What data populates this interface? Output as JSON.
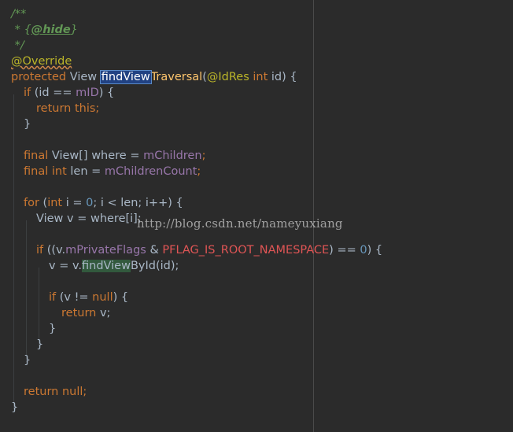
{
  "code": {
    "doc_open": "/**",
    "doc_line": " * {@hide}",
    "doc_close": " */",
    "annotation": "@Override",
    "sig_protected": "protected",
    "sig_view": "View",
    "sig_method": "findView",
    "sig_method_rest": "Traversal",
    "sig_params_open": "(",
    "sig_idres": "@IdRes",
    "sig_int": "int",
    "sig_params_close": " id) {",
    "if1_kw": "if",
    "if1_open": " (id == ",
    "if1_field": "mID",
    "if1_close": ") {",
    "ret_this_kw": "return",
    "ret_this_val": " this;",
    "close_brace": "}",
    "final1_kw": "final",
    "final1_type": " View[] where = ",
    "final1_field": "mChildren",
    "semicolon": ";",
    "final2_kw": "final",
    "final2_int": " int",
    "final2_name": " len = ",
    "final2_field": "mChildrenCount",
    "for_kw": "for",
    "for_open": " (",
    "for_int": "int",
    "for_i": " i = ",
    "for_zero": "0",
    "for_rest": "; i < len; i++) {",
    "view_v": "View v = where[i];",
    "if2_kw": "if",
    "if2_open": " ((v.",
    "if2_field": "mPrivateFlags",
    "if2_amp": " & ",
    "if2_const": "PFLAG_IS_ROOT_NAMESPACE",
    "if2_eq": ") == ",
    "if2_zero": "0",
    "if2_close": ") {",
    "assign_prefix": "v = v.",
    "assign_hl": "findView",
    "assign_suffix": "ById(id);",
    "if3_kw": "if",
    "if3_open": " (v != ",
    "if3_null": "null",
    "if3_close": ") {",
    "ret_v_kw": "return",
    "ret_v_val": " v;",
    "ret_null_kw": "return",
    "ret_null_val": " null;"
  },
  "watermark": "http://blog.csdn.net/nameyuxiang"
}
